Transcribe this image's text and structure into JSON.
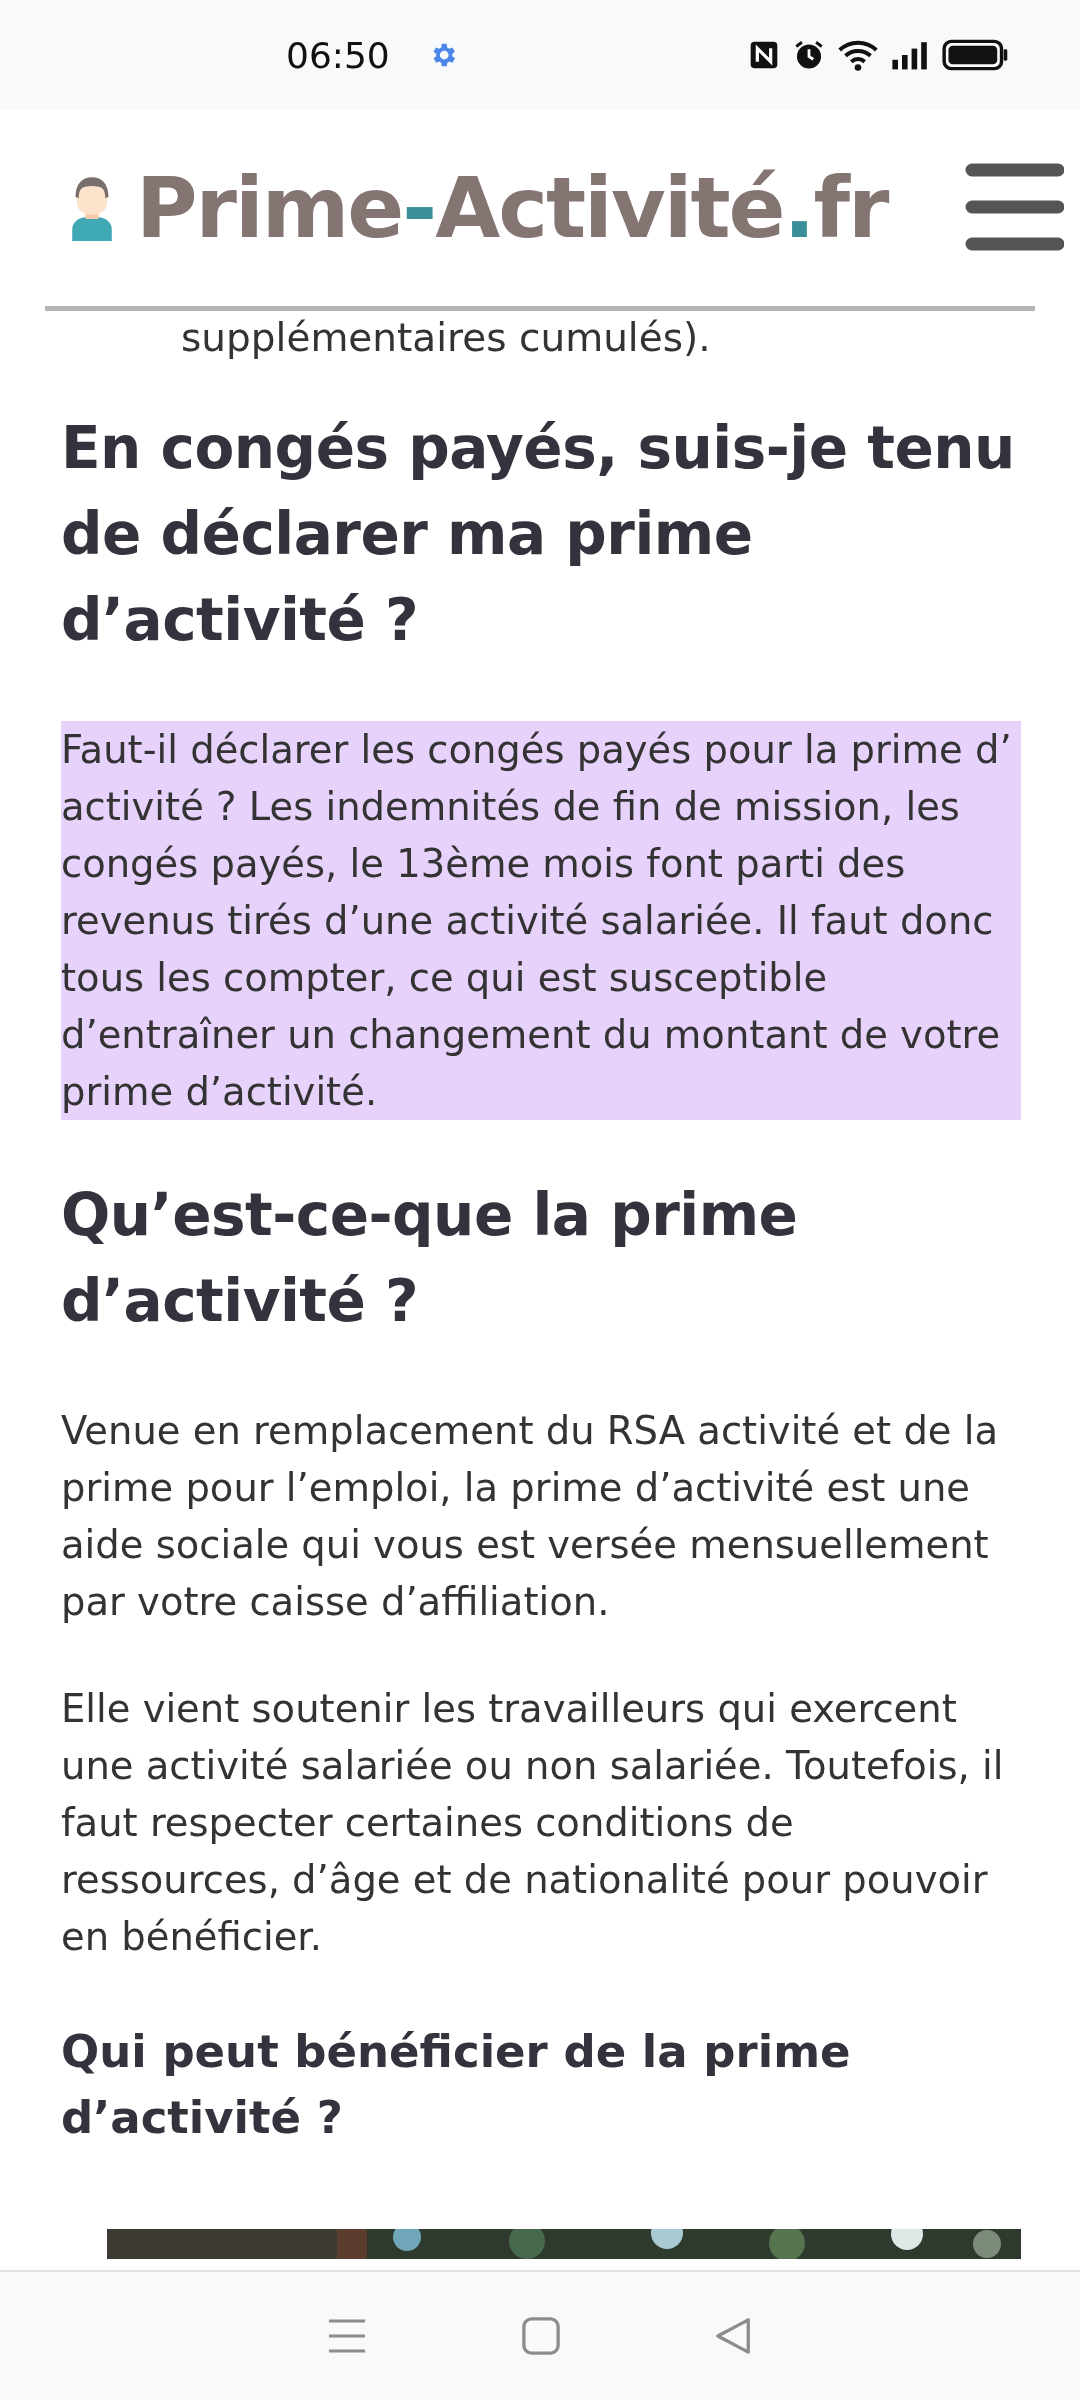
{
  "status_bar": {
    "time": "06:50"
  },
  "header": {
    "logo": [
      {
        "text": "Prime",
        "kind": "word"
      },
      {
        "text": "-",
        "kind": "accent"
      },
      {
        "text": "Activité",
        "kind": "word"
      },
      {
        "text": ".",
        "kind": "accent"
      },
      {
        "text": "fr",
        "kind": "word"
      }
    ]
  },
  "article": [
    {
      "kind": "fragment",
      "text": "supplémentaires cumulés)."
    },
    {
      "kind": "h2",
      "text": "En congés payés, suis-je tenu de déclarer ma prime d’activité ?"
    },
    {
      "kind": "p",
      "highlighted": true,
      "text": "Faut-il déclarer les congés payés pour la prime d’ activité ? Les indemnités de fin de mission, les congés payés, le 13ème mois font parti des revenus tirés d’une activité salariée. Il faut donc tous les compter, ce qui est susceptible d’entraîner un changement du montant de votre prime d’activité."
    },
    {
      "kind": "h2",
      "text": "Qu’est-ce-que la prime d’activité ?"
    },
    {
      "kind": "p",
      "highlighted": false,
      "text": "Venue en remplacement du RSA activité et de la prime pour l’emploi, la prime d’activité est une aide sociale qui vous est versée mensuellement par votre caisse d’affiliation."
    },
    {
      "kind": "p",
      "highlighted": false,
      "text": "Elle vient soutenir les travailleurs qui exercent une activité salariée ou non salariée. Toutefois, il faut respecter certaines conditions de ressources, d’âge et de nationalité pour pouvoir en bénéficier."
    },
    {
      "kind": "h3",
      "text": "Qui peut bénéficier de la prime d’activité ?"
    },
    {
      "kind": "picture"
    }
  ]
}
